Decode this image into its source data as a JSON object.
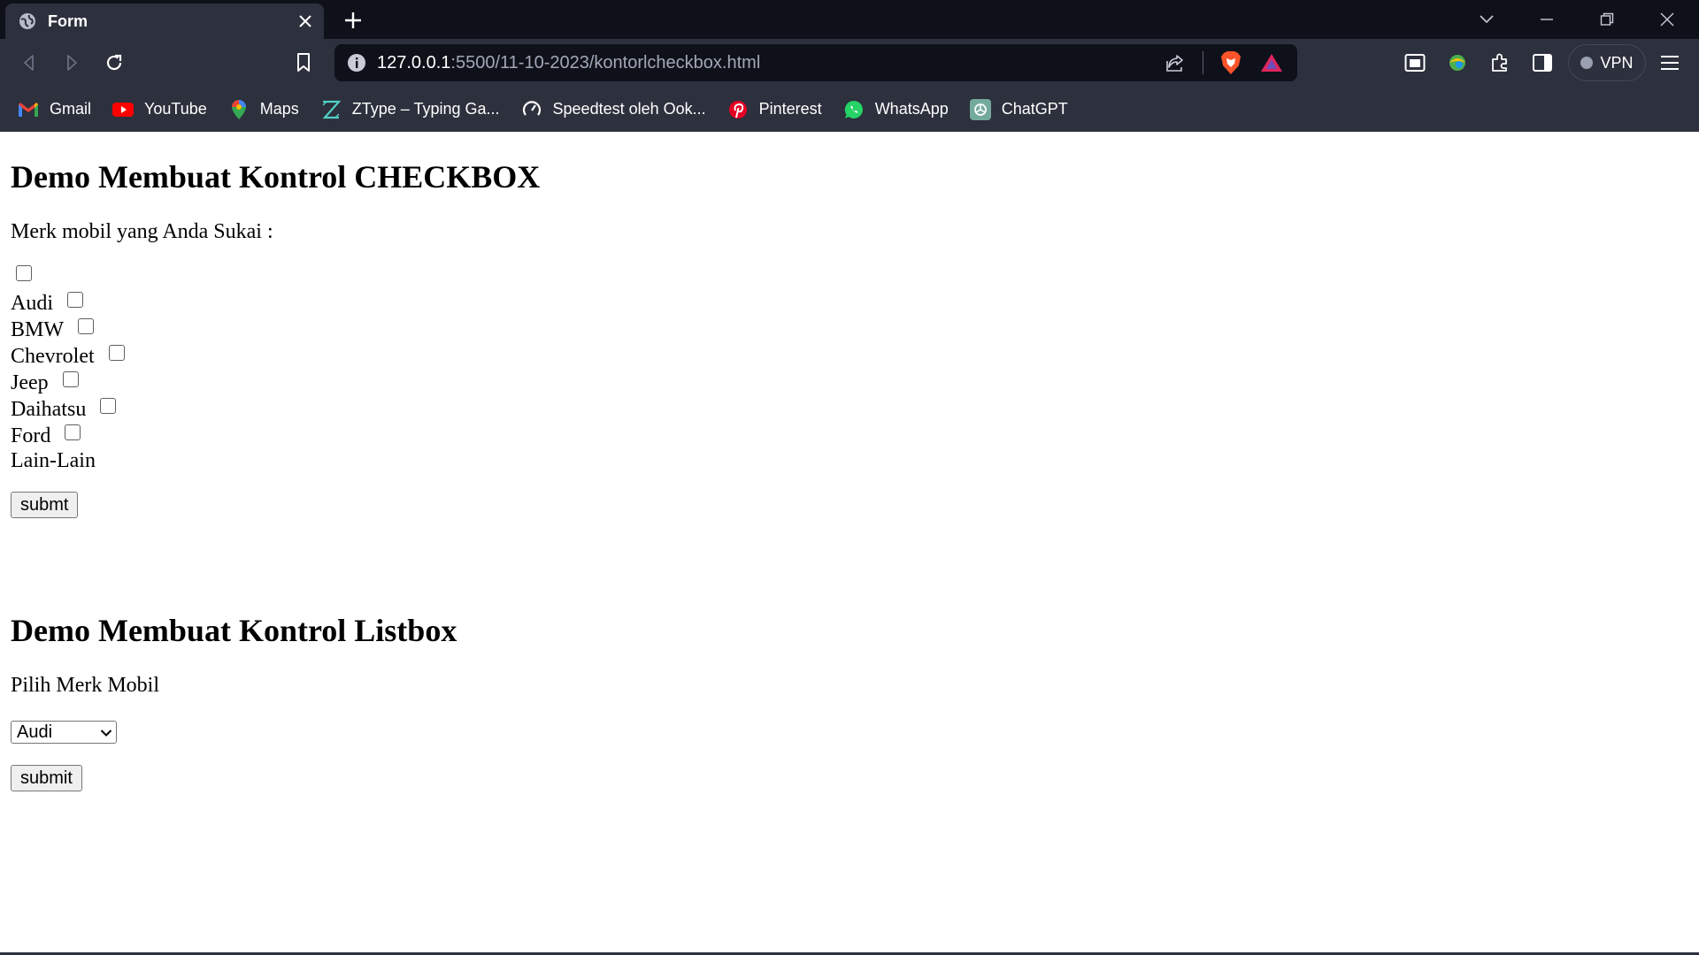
{
  "browser": {
    "tab_title": "Form",
    "url_host": "127.0.0.1",
    "url_path": ":5500/11-10-2023/kontorlcheckbox.html",
    "vpn_label": "VPN",
    "bookmarks": [
      {
        "label": "Gmail",
        "icon": "gmail-icon"
      },
      {
        "label": "YouTube",
        "icon": "youtube-icon"
      },
      {
        "label": "Maps",
        "icon": "maps-icon"
      },
      {
        "label": "ZType – Typing Ga...",
        "icon": "ztype-icon"
      },
      {
        "label": "Speedtest oleh Ook...",
        "icon": "speedtest-icon"
      },
      {
        "label": "Pinterest",
        "icon": "pinterest-icon"
      },
      {
        "label": "WhatsApp",
        "icon": "whatsapp-icon"
      },
      {
        "label": "ChatGPT",
        "icon": "chatgpt-icon"
      }
    ]
  },
  "checkbox_section": {
    "heading": "Demo Membuat Kontrol CHECKBOX",
    "prompt": "Merk mobil yang Anda Sukai :",
    "options": [
      "Audi",
      "BMW",
      "Chevrolet",
      "Jeep",
      "Daihatsu",
      "Ford",
      "Lain-Lain"
    ],
    "submit_label": "submt"
  },
  "listbox_section": {
    "heading": "Demo Membuat Kontrol Listbox",
    "prompt": "Pilih Merk Mobil",
    "selected": "Audi",
    "submit_label": "submit"
  },
  "colors": {
    "tabbar": "#0f111a",
    "toolbar": "#2d303d"
  }
}
